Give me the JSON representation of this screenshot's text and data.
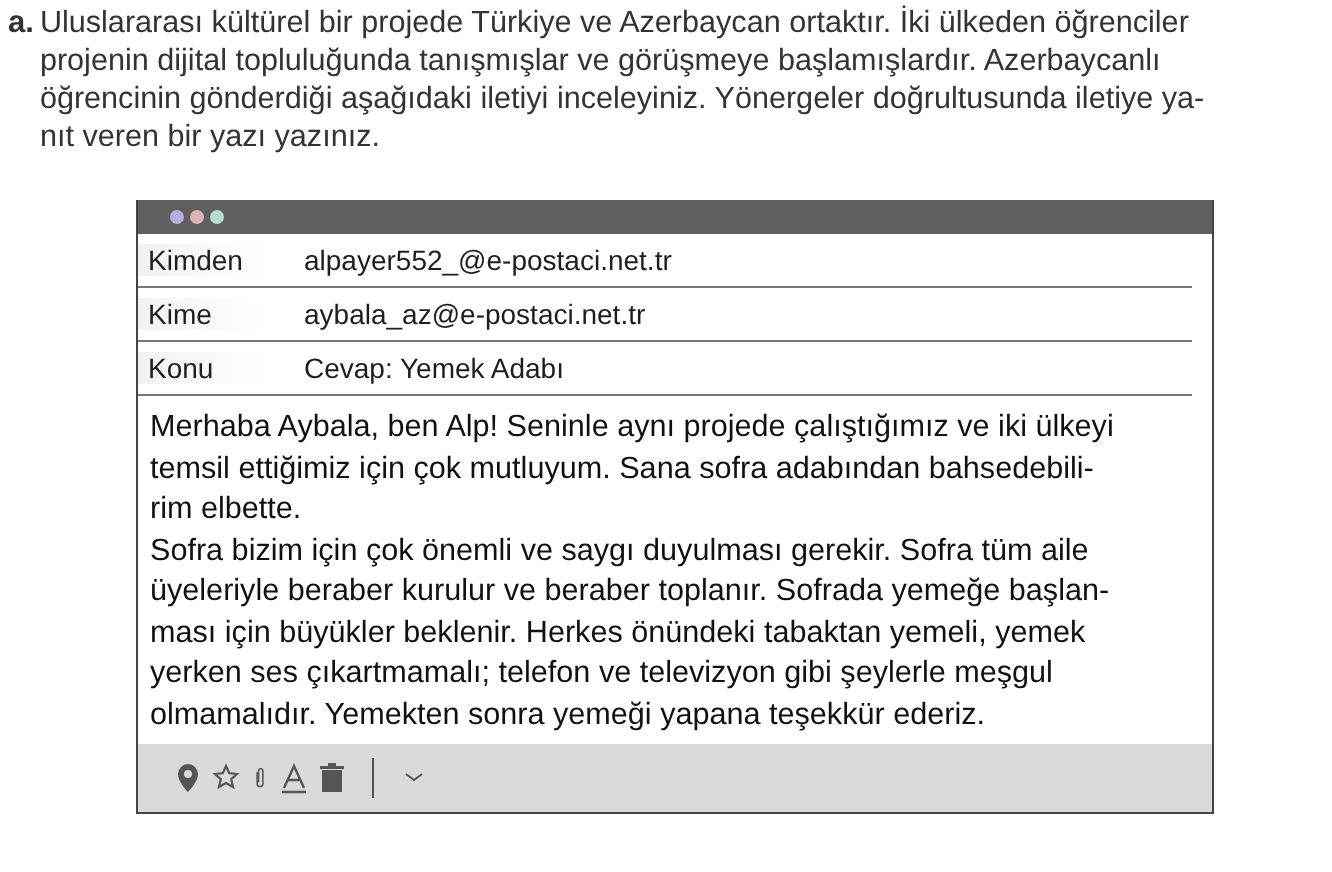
{
  "task": {
    "marker": "a.",
    "lines": [
      "Uluslararası kültürel bir projede Türkiye ve Azerbaycan ortaktır. İki ülkeden öğrenciler",
      "projenin dijital topluluğunda tanışmışlar ve görüşmeye başlamışlardır. Azerbaycanlı",
      "öğrencinin gönderdiği aşağıdaki iletiyi inceleyiniz. Yönergeler doğrultusunda iletiye ya-",
      "nıt veren bir yazı yazınız."
    ]
  },
  "email": {
    "headers": [
      {
        "label": "Kimden",
        "value": "alpayer552_@e-postaci.net.tr"
      },
      {
        "label": "Kime",
        "value": "aybala_az@e-postaci.net.tr"
      },
      {
        "label": "Konu",
        "value": "Cevap: Yemek Adabı"
      }
    ],
    "body": [
      "Merhaba Aybala, ben Alp! Seninle aynı projede çalıştığımız ve iki ülkeyi",
      "temsil ettiğimiz için çok mutluyum. Sana sofra adabından bahsedebili-",
      "rim elbette.",
      "Sofra bizim için çok önemli ve saygı duyulması gerekir. Sofra tüm aile",
      "üyeleriyle beraber kurulur ve beraber toplanır. Sofrada yemeğe başlan-",
      "ması için büyükler beklenir. Herkes önündeki tabaktan yemeli, yemek",
      "yerken ses çıkartmamalı; telefon ve televizyon gibi şeylerle meşgul",
      "olmamalıdır. Yemekten sonra yemeği yapana teşekkür ederiz."
    ]
  }
}
